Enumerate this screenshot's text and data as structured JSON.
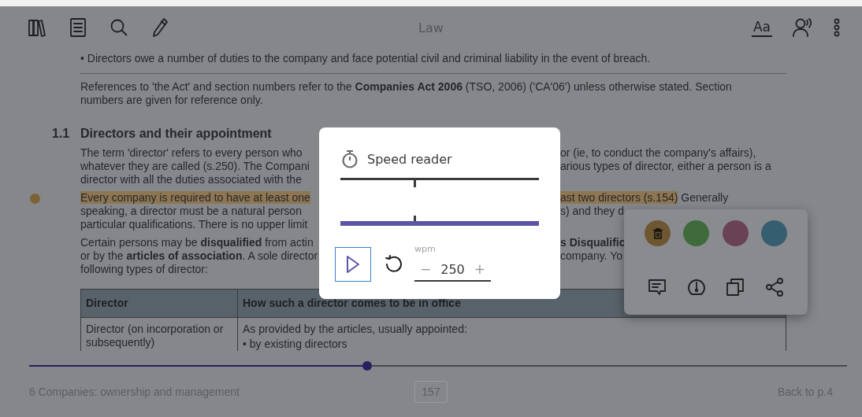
{
  "toolbar": {
    "title": "Law",
    "font_button": "Aa"
  },
  "intro": {
    "bullet": "• Directors owe a number of duties to the company and face potential civil and criminal liability in the event of breach.",
    "note": "References to 'the Act' and section numbers refer to the **Companies Act 2006** (TSO, 2006) ('CA'06') unless otherwise stated. Section numbers are given for reference only."
  },
  "section": {
    "number": "1.1",
    "title": "Directors and their appointment"
  },
  "paragraphs": [
    {
      "lines": [
        {
          "left": [
            {
              "text": "The term 'director' refers to every person who",
              "highlighted": false
            }
          ],
          "right": [
            {
              "text": "or (ie, to conduct the company's affairs),",
              "highlighted": false
            }
          ]
        },
        {
          "left": [
            {
              "text": "whatever they are called (s.250). The Compani",
              "highlighted": false
            }
          ],
          "right": [
            {
              "text": "arious types of director, either a person is a",
              "highlighted": false
            }
          ]
        },
        {
          "left": [
            {
              "text": "director with all the duties associated with the",
              "highlighted": false
            }
          ]
        }
      ]
    },
    {
      "marker": {
        "color": "#7a6235"
      },
      "lines": [
        {
          "left": [
            {
              "text": "Every company is required to have at least one",
              "highlighted": true
            }
          ],
          "right": [
            {
              "text": "ast two directors (s.154)",
              "highlighted": true
            },
            {
              "text": " Generally",
              "highlighted": false
            }
          ]
        },
        {
          "left": [
            {
              "text": "speaking, a director must be a natural person",
              "highlighted": false
            }
          ],
          "right": [
            {
              "text": "s) and they d",
              "highlighted": false
            }
          ]
        },
        {
          "left": [
            {
              "text": "particular qualifications. There is no upper limit",
              "highlighted": false
            }
          ]
        }
      ]
    },
    {
      "lines": [
        {
          "left": [
            {
              "text": "Certain persons may be **disqualified** from actin",
              "highlighted": false
            }
          ],
          "right": [
            {
              "text": "**s Disqualific**",
              "highlighted": false
            }
          ]
        },
        {
          "left": [
            {
              "text": "or by the **articles of association**. A sole director",
              "highlighted": false
            }
          ],
          "right": [
            {
              "text": "company. Yo",
              "highlighted": false
            }
          ]
        },
        {
          "left": [
            {
              "text": "following types of director:",
              "highlighted": false
            }
          ]
        }
      ]
    }
  ],
  "table": {
    "columns": [
      "Director",
      "How such a director comes to be in office"
    ],
    "rows": [
      {
        "cells": [
          {
            "text": "Director (on incorporation or subsequently)"
          },
          {
            "text": "As provided by the articles, usually appointed:",
            "bullets": [
              "• by existing directors"
            ]
          }
        ]
      }
    ]
  },
  "progress": {
    "level": 0.413
  },
  "footer": {
    "chapter": "6 Companies: ownership and management",
    "page": "157",
    "back": "Back to p.4"
  },
  "speed_reader": {
    "title": "Speed reader",
    "wpm_label": "wpm",
    "decrease": "−",
    "wpm": "250",
    "increase": "+",
    "play_focused": true
  },
  "highlight_menu": {
    "swatches": [
      {
        "color": "#6e5630",
        "selected": true
      },
      {
        "color": "#3f6b3c",
        "selected": false
      },
      {
        "color": "#6a4256",
        "selected": false
      },
      {
        "color": "#355e70",
        "selected": false
      }
    ]
  }
}
